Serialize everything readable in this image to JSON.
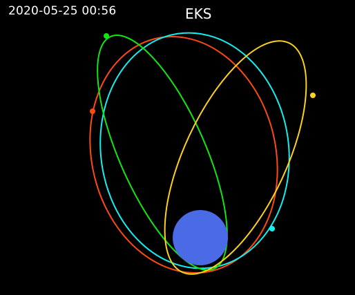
{
  "timestamp": "2020-05-25 00:56",
  "title": "EKS",
  "colors": {
    "background": "#000000",
    "earth": "#4a6ae6",
    "orbit_red": "#ff4a12",
    "orbit_green": "#12e612",
    "orbit_yellow": "#ffd21f",
    "orbit_cyan": "#12f0f0"
  },
  "satellites": [
    {
      "name": "satellite-red",
      "color": "#ff4a12"
    },
    {
      "name": "satellite-green",
      "color": "#12e612"
    },
    {
      "name": "satellite-yellow",
      "color": "#ffd21f"
    },
    {
      "name": "satellite-cyan",
      "color": "#12f0f0"
    }
  ]
}
